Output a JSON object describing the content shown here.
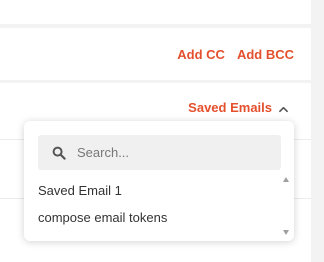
{
  "toolbar": {
    "add_cc_label": "Add CC",
    "add_bcc_label": "Add BCC",
    "saved_emails_label": "Saved Emails"
  },
  "dropdown": {
    "search_placeholder": "Search...",
    "search_value": "",
    "options": [
      {
        "label": "Saved Email 1"
      },
      {
        "label": "compose email tokens"
      }
    ]
  },
  "colors": {
    "accent": "#e4502d",
    "background": "#f3f3f3"
  },
  "icons": {
    "search": "search-icon",
    "chevron": "chevron-up-icon"
  }
}
